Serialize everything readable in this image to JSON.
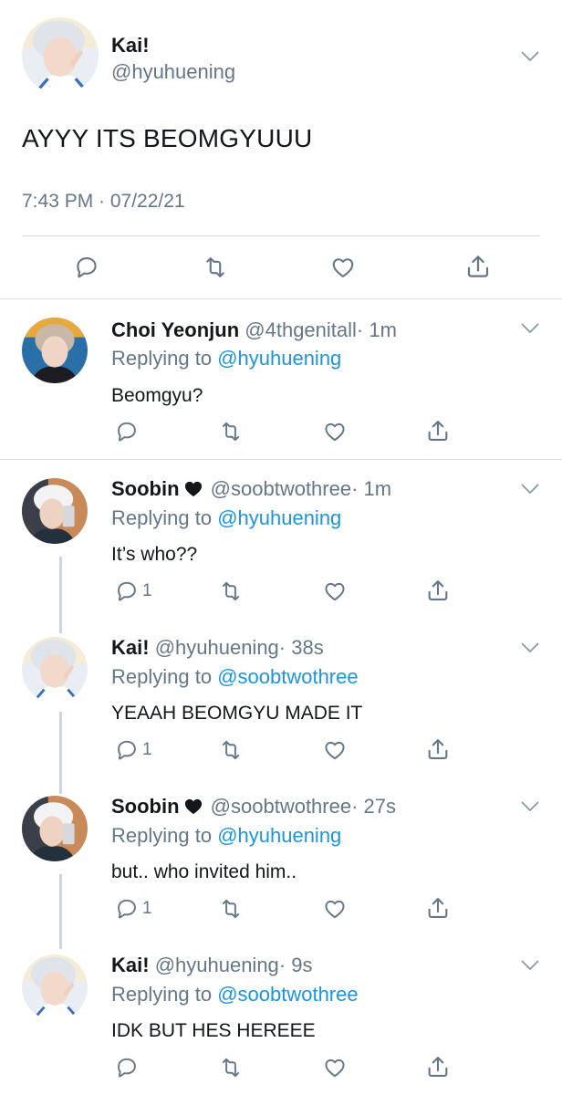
{
  "main": {
    "name": "Kai!",
    "handle": "@hyuhuening",
    "text": "AYYY ITS BEOMGYUUU",
    "timestamp": "7:43 PM · 07/22/21"
  },
  "replies": [
    {
      "name": "Choi Yeonjun",
      "handle": "@4thgenitall",
      "time": "· 1m",
      "replying_prefix": "Replying to ",
      "replying_to": "@hyuhuening",
      "text": "Beomgyu?",
      "reply_count": ""
    },
    {
      "name": "Soobin",
      "has_heart": true,
      "handle": "@soobtwothree",
      "time": "· 1m",
      "replying_prefix": "Replying to ",
      "replying_to": "@hyuhuening",
      "text": "It’s who??",
      "reply_count": "1"
    },
    {
      "name": "Kai!",
      "handle": "@hyuhuening",
      "time": "· 38s",
      "replying_prefix": "Replying to ",
      "replying_to": "@soobtwothree",
      "text": "YEAAH BEOMGYU MADE IT",
      "reply_count": "1"
    },
    {
      "name": "Soobin",
      "has_heart": true,
      "handle": "@soobtwothree",
      "time": "· 27s",
      "replying_prefix": "Replying to ",
      "replying_to": "@hyuhuening",
      "text": "but.. who invited him..",
      "reply_count": "1"
    },
    {
      "name": "Kai!",
      "handle": "@hyuhuening",
      "time": "· 9s",
      "replying_prefix": "Replying to ",
      "replying_to": "@soobtwothree",
      "text": "IDK BUT HES HEREEE",
      "reply_count": ""
    }
  ],
  "colors": {
    "text": "#14171a",
    "secondary": "#657786",
    "link": "#1b95e0",
    "divider": "#d9dde1"
  },
  "icons": [
    "reply-icon",
    "retweet-icon",
    "like-icon",
    "share-icon",
    "chevron-down-icon",
    "heart-icon"
  ]
}
